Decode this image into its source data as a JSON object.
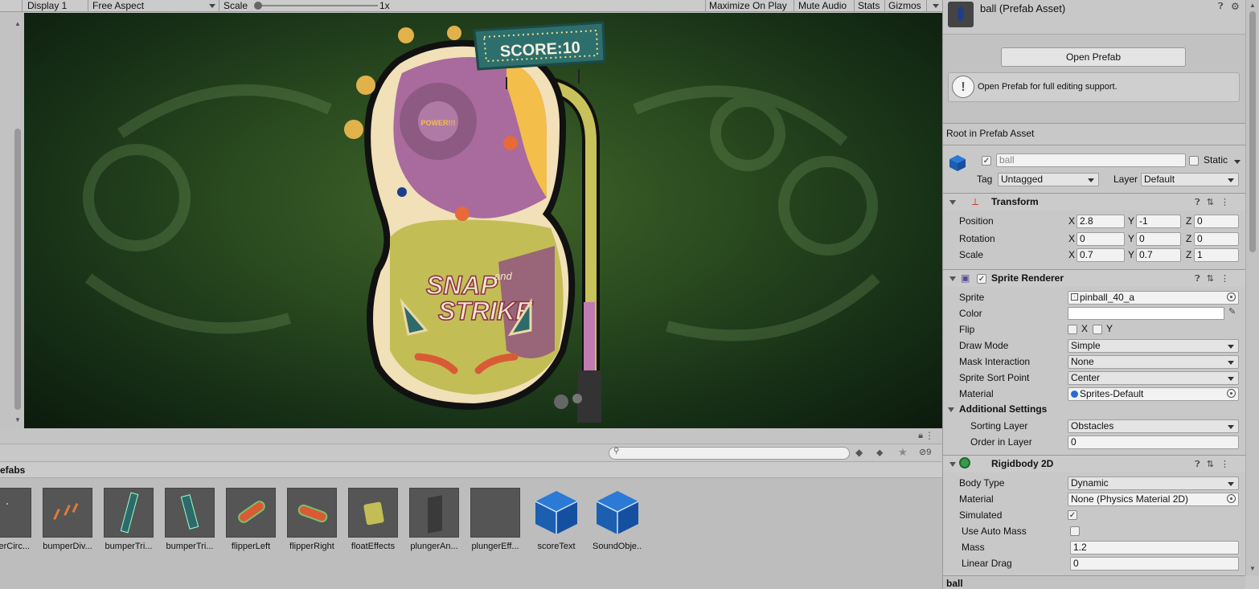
{
  "toolbar": {
    "display": "Display 1",
    "aspect": "Free Aspect",
    "scale_label": "Scale",
    "scale_value": "1x",
    "maximize": "Maximize On Play",
    "mute": "Mute Audio",
    "stats": "Stats",
    "gizmos": "Gizmos"
  },
  "game": {
    "score_text": "SCORE:10",
    "title_line1": "SNAP",
    "title_and": "and",
    "title_line2": "STRIKE",
    "power_label": "POWER!!!"
  },
  "project": {
    "folder": "efabs",
    "search_placeholder": "",
    "hidden_count": "9",
    "assets": [
      {
        "label": "perCirc..."
      },
      {
        "label": "bumperDiv..."
      },
      {
        "label": "bumperTri..."
      },
      {
        "label": "bumperTri..."
      },
      {
        "label": "flipperLeft"
      },
      {
        "label": "flipperRight"
      },
      {
        "label": "floatEffects"
      },
      {
        "label": "plungerAn..."
      },
      {
        "label": "plungerEff..."
      },
      {
        "label": "scoreText"
      },
      {
        "label": "SoundObje..."
      }
    ]
  },
  "inspector": {
    "asset_title": "ball (Prefab Asset)",
    "open_prefab": "Open Prefab",
    "info_text": "Open Prefab for full editing support.",
    "root_label": "Root in Prefab Asset",
    "object_name": "ball",
    "static_label": "Static",
    "tag_label": "Tag",
    "tag_value": "Untagged",
    "layer_label": "Layer",
    "layer_value": "Default",
    "transform": {
      "title": "Transform",
      "position_label": "Position",
      "rotation_label": "Rotation",
      "scale_label": "Scale",
      "position": {
        "x": "2.8",
        "y": "-1",
        "z": "0"
      },
      "rotation": {
        "x": "0",
        "y": "0",
        "z": "0"
      },
      "scale": {
        "x": "0.7",
        "y": "0.7",
        "z": "1"
      },
      "axis_x": "X",
      "axis_y": "Y",
      "axis_z": "Z"
    },
    "sprite_renderer": {
      "title": "Sprite Renderer",
      "sprite_label": "Sprite",
      "sprite_value": "pinball_40_a",
      "color_label": "Color",
      "flip_label": "Flip",
      "flip_x": "X",
      "flip_y": "Y",
      "draw_mode_label": "Draw Mode",
      "draw_mode_value": "Simple",
      "mask_label": "Mask Interaction",
      "mask_value": "None",
      "sort_point_label": "Sprite Sort Point",
      "sort_point_value": "Center",
      "material_label": "Material",
      "material_value": "Sprites-Default",
      "additional_label": "Additional Settings",
      "sorting_layer_label": "Sorting Layer",
      "sorting_layer_value": "Obstacles",
      "order_label": "Order in Layer",
      "order_value": "0"
    },
    "rigidbody": {
      "title": "Rigidbody 2D",
      "body_type_label": "Body Type",
      "body_type_value": "Dynamic",
      "material_label": "Material",
      "material_value": "None (Physics Material 2D)",
      "simulated_label": "Simulated",
      "auto_mass_label": "Use Auto Mass",
      "mass_label": "Mass",
      "mass_value": "1.2",
      "linear_drag_label": "Linear Drag",
      "linear_drag_value": "0"
    },
    "footer_label": "ball"
  }
}
